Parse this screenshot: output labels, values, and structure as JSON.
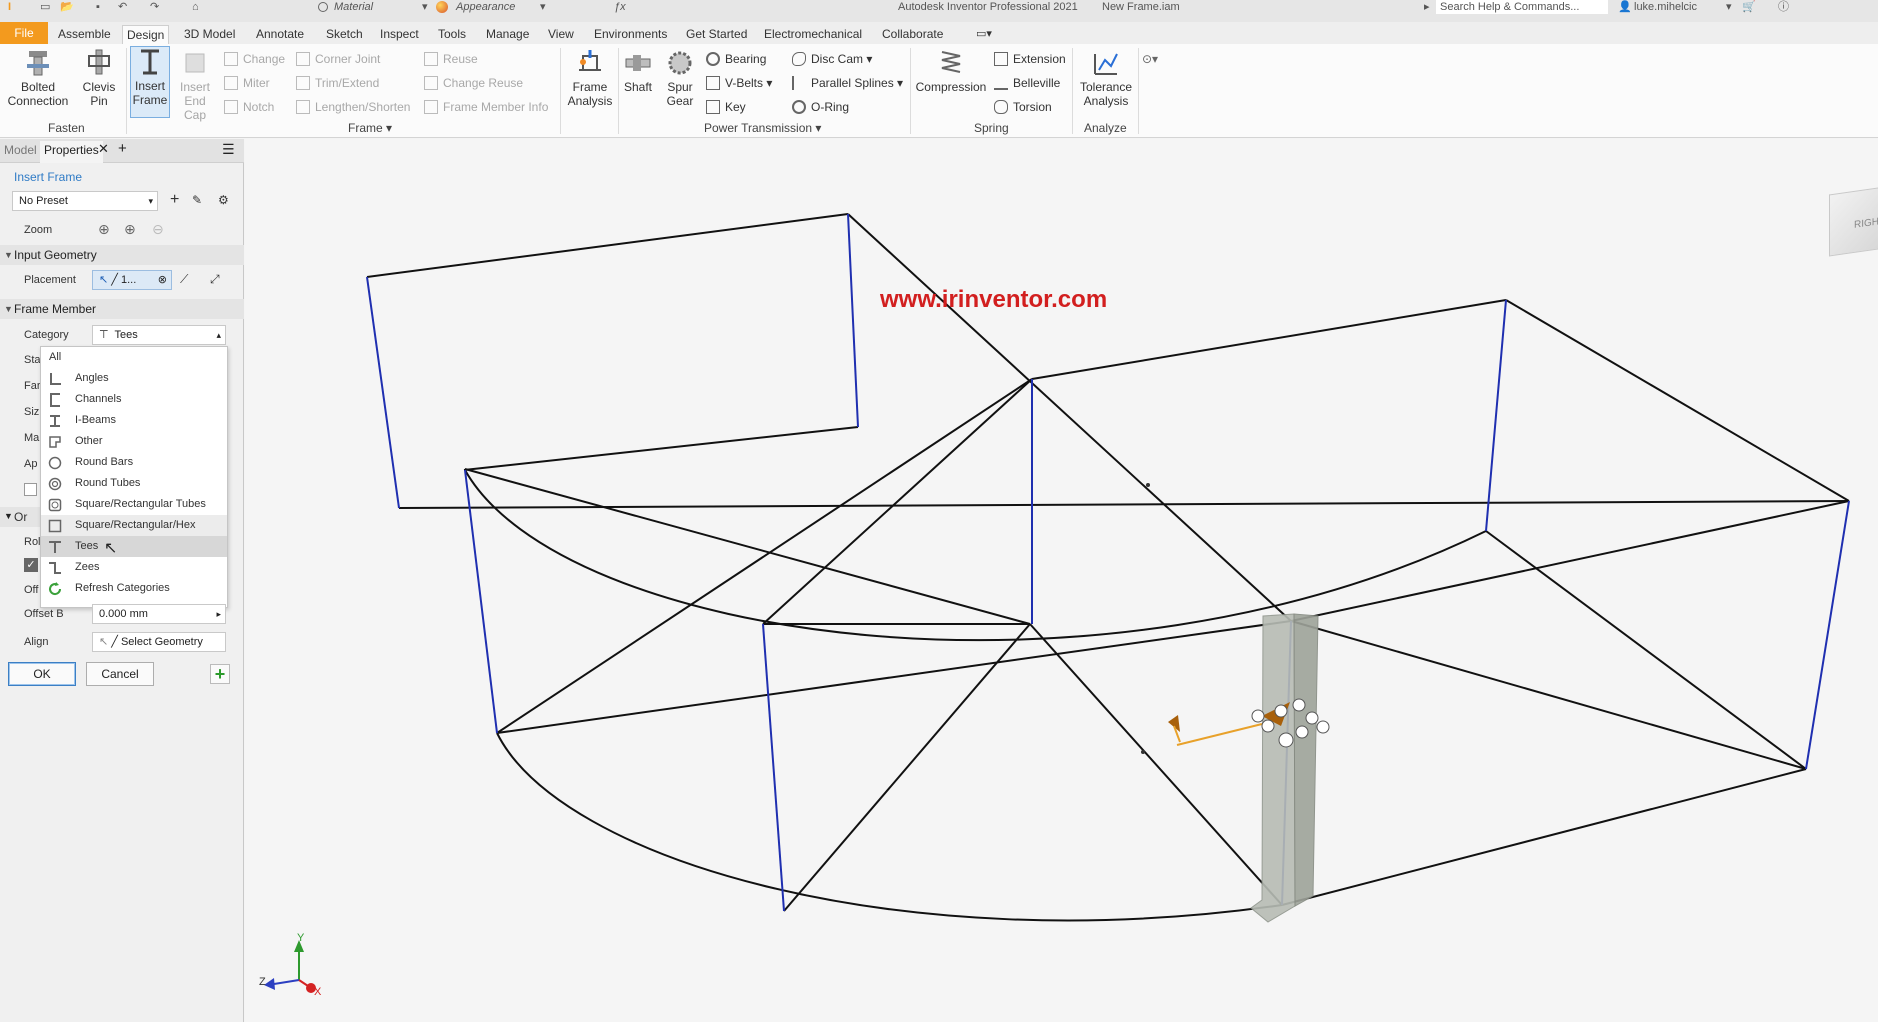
{
  "titlebar": {
    "material": "Material",
    "appearance": "Appearance",
    "app_title": "Autodesk Inventor Professional 2021",
    "document": "New Frame.iam",
    "search_placeholder": "Search Help & Commands...",
    "user": "luke.mihelcic"
  },
  "tabs": [
    "File",
    "Assemble",
    "Design",
    "3D Model",
    "Annotate",
    "Sketch",
    "Inspect",
    "Tools",
    "Manage",
    "View",
    "Environments",
    "Get Started",
    "Electromechanical",
    "Collaborate"
  ],
  "active_tab": "Design",
  "ribbon": {
    "fasten": {
      "label": "Fasten",
      "bolted_connection": "Bolted\nConnection",
      "clevis_pin": "Clevis\nPin"
    },
    "frame": {
      "label": "Frame",
      "insert_frame": "Insert\nFrame",
      "insert_end_cap": "Insert\nEnd Cap",
      "change": "Change",
      "miter": "Miter",
      "notch": "Notch",
      "corner_joint": "Corner Joint",
      "trim_extend": "Trim/Extend",
      "lengthen_shorten": "Lengthen/Shorten",
      "reuse": "Reuse",
      "change_reuse": "Change Reuse",
      "frame_member_info": "Frame Member Info",
      "frame_analysis": "Frame\nAnalysis"
    },
    "power_transmission": {
      "label": "Power Transmission",
      "shaft": "Shaft",
      "spur_gear": "Spur\nGear",
      "bearing": "Bearing",
      "v_belts": "V-Belts",
      "key": "Key",
      "disc_cam": "Disc Cam",
      "parallel_splines": "Parallel Splines",
      "o_ring": "O-Ring"
    },
    "spring": {
      "label": "Spring",
      "compression": "Compression",
      "extension": "Extension",
      "belleville": "Belleville",
      "torsion": "Torsion"
    },
    "analyze": {
      "label": "Analyze",
      "tolerance_analysis": "Tolerance\nAnalysis"
    }
  },
  "panel": {
    "tab_model": "Model",
    "tab_properties": "Properties",
    "title": "Insert Frame",
    "preset": "No Preset",
    "zoom_label": "Zoom",
    "input_geometry": "Input Geometry",
    "placement_label": "Placement",
    "placement_value": "1...",
    "frame_member": "Frame Member",
    "category_label": "Category",
    "category_value": "Tees",
    "partial_labels": [
      "Sta",
      "Far",
      "Siz",
      "Ma",
      "Ap",
      "Or",
      "Rol",
      "Off"
    ],
    "offset_b_label": "Offset B",
    "offset_b_value": "0.000 mm",
    "align_label": "Align",
    "align_value": "Select Geometry",
    "ok": "OK",
    "cancel": "Cancel"
  },
  "category_dropdown": {
    "items": [
      "All",
      "Angles",
      "Channels",
      "I-Beams",
      "Other",
      "Round Bars",
      "Round Tubes",
      "Square/Rectangular Tubes",
      "Square/Rectangular/Hex Tubes",
      "Tees",
      "Zees",
      "Refresh Categories"
    ],
    "selected": "Tees"
  },
  "viewport": {
    "watermark": "www.irinventor.com",
    "viewcube_label": "RIGH",
    "axis_x": "X",
    "axis_y": "Y",
    "axis_z": "Z"
  },
  "colors": {
    "file_tab": "#f39a1e",
    "sketch_line": "#111111",
    "selected_line": "#1f2fb0",
    "watermark": "#d21f1f"
  }
}
